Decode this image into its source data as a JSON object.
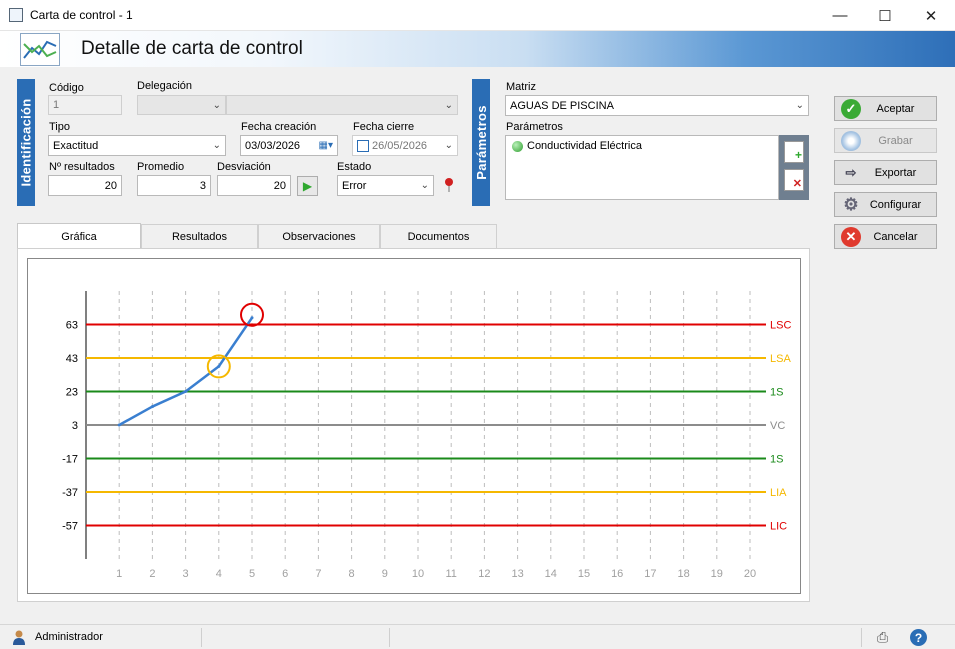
{
  "window": {
    "title": "Carta de control - 1"
  },
  "header": {
    "title": "Detalle de carta de control"
  },
  "side_tabs": {
    "identificacion": "Identificación",
    "parametros": "Parámetros"
  },
  "form": {
    "codigo": {
      "label": "Código",
      "value": "1"
    },
    "delegacion": {
      "label": "Delegación",
      "value": ""
    },
    "tipo": {
      "label": "Tipo",
      "value": "Exactitud"
    },
    "fecha_creacion": {
      "label": "Fecha creación",
      "value": "03/03/2026"
    },
    "fecha_cierre": {
      "label": "Fecha cierre",
      "value": "26/05/2026",
      "checked": false
    },
    "num_resultados": {
      "label": "Nº resultados",
      "value": "20"
    },
    "promedio": {
      "label": "Promedio",
      "value": "3"
    },
    "desviacion": {
      "label": "Desviación",
      "value": "20"
    },
    "estado": {
      "label": "Estado",
      "value": "Error"
    }
  },
  "matriz": {
    "label": "Matriz",
    "value": "AGUAS DE PISCINA"
  },
  "parametros": {
    "label": "Parámetros",
    "items": [
      "Conductividad Eléctrica"
    ]
  },
  "buttons": {
    "aceptar": "Aceptar",
    "grabar": "Grabar",
    "exportar": "Exportar",
    "configurar": "Configurar",
    "cancelar": "Cancelar"
  },
  "tabs": [
    "Gráfica",
    "Resultados",
    "Observaciones",
    "Documentos"
  ],
  "status": {
    "user": "Administrador"
  },
  "colors": {
    "lsc": "#e00000",
    "lsa": "#f5b800",
    "s1": "#1a8a1a",
    "vc": "#8c8c8c",
    "series": "#3a7fd0",
    "accent": "#2a6db5"
  },
  "chart_data": {
    "type": "line",
    "x": [
      1,
      2,
      3,
      4,
      5
    ],
    "y": [
      3,
      14,
      23,
      38,
      67
    ],
    "x_ticks": [
      "1",
      "2",
      "3",
      "4",
      "5",
      "6",
      "7",
      "8",
      "9",
      "10",
      "11",
      "12",
      "13",
      "14",
      "15",
      "16",
      "17",
      "18",
      "19",
      "20"
    ],
    "y_ticks": [
      "63",
      "43",
      "23",
      "3",
      "-17",
      "-37",
      "-57"
    ],
    "ylim": [
      -77,
      83
    ],
    "xlim": [
      0,
      20
    ],
    "limit_lines": [
      {
        "name": "LSC",
        "value": 63,
        "color": "#e00000"
      },
      {
        "name": "LSA",
        "value": 43,
        "color": "#f5b800"
      },
      {
        "name": "1S",
        "value": 23,
        "color": "#1a8a1a"
      },
      {
        "name": "VC",
        "value": 3,
        "color": "#8c8c8c"
      },
      {
        "name": "1S",
        "value": -17,
        "color": "#1a8a1a"
      },
      {
        "name": "LIA",
        "value": -37,
        "color": "#f5b800"
      },
      {
        "name": "LIC",
        "value": -57,
        "color": "#e00000"
      }
    ],
    "highlighted_points": [
      {
        "x": 4,
        "y": 38,
        "color": "#f5b800"
      },
      {
        "x": 5,
        "y": 67,
        "color": "#e00000"
      }
    ],
    "vertical_grid": "dashed"
  }
}
